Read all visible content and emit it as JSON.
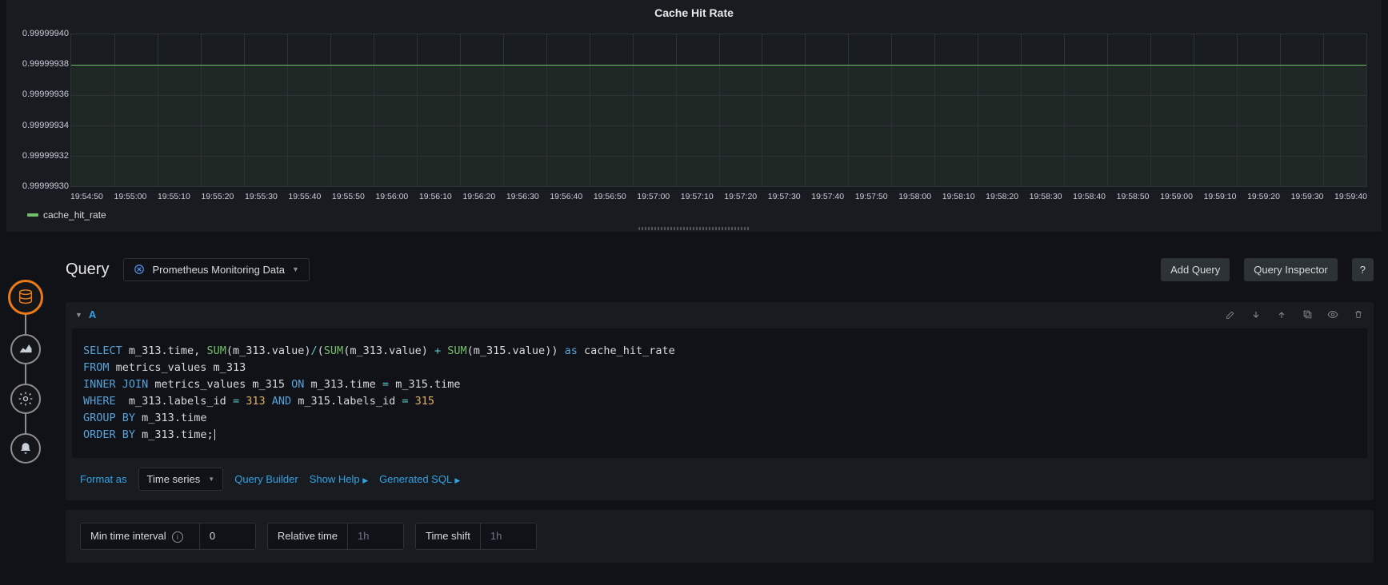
{
  "chart_data": {
    "type": "line",
    "title": "Cache Hit Rate",
    "xlabel": "",
    "ylabel": "",
    "ylim": [
      0.9999993,
      0.9999994
    ],
    "y_ticks": [
      "0.99999940",
      "0.99999938",
      "0.99999936",
      "0.99999934",
      "0.99999932",
      "0.99999930"
    ],
    "x_ticks": [
      "19:54:50",
      "19:55:00",
      "19:55:10",
      "19:55:20",
      "19:55:30",
      "19:55:40",
      "19:55:50",
      "19:56:00",
      "19:56:10",
      "19:56:20",
      "19:56:30",
      "19:56:40",
      "19:56:50",
      "19:57:00",
      "19:57:10",
      "19:57:20",
      "19:57:30",
      "19:57:40",
      "19:57:50",
      "19:58:00",
      "19:58:10",
      "19:58:20",
      "19:58:30",
      "19:58:40",
      "19:58:50",
      "19:59:00",
      "19:59:10",
      "19:59:20",
      "19:59:30",
      "19:59:40"
    ],
    "series": [
      {
        "name": "cache_hit_rate",
        "color": "#73bf69",
        "value": 0.99999938
      }
    ]
  },
  "legend": {
    "series_name": "cache_hit_rate"
  },
  "query_section": {
    "title": "Query",
    "datasource": "Prometheus Monitoring Data",
    "add_query_btn": "Add Query",
    "inspector_btn": "Query Inspector",
    "help_btn": "?",
    "query_letter": "A"
  },
  "sql": {
    "l1a": "SELECT",
    "l1b": " m_313.time, ",
    "l1c": "SUM",
    "l1d": "(m_313.value)",
    "l1e": "/",
    "l1f": "(",
    "l1g": "SUM",
    "l1h": "(m_313.value) ",
    "l1i": "+",
    "l1j": " ",
    "l1k": "SUM",
    "l1l": "(m_315.value)) ",
    "l1m": "as",
    "l1n": " cache_hit_rate",
    "l2a": "FROM",
    "l2b": " metrics_values m_313",
    "l3a": "INNER",
    "l3b": " ",
    "l3c": "JOIN",
    "l3d": " metrics_values m_315 ",
    "l3e": "ON",
    "l3f": " m_313.time ",
    "l3g": "=",
    "l3h": " m_315.time",
    "l4a": "WHERE",
    "l4b": "  m_313.labels_id ",
    "l4c": "=",
    "l4d": " ",
    "l4e": "313",
    "l4f": " ",
    "l4g": "AND",
    "l4h": " m_315.labels_id ",
    "l4i": "=",
    "l4j": " ",
    "l4k": "315",
    "l5a": "GROUP",
    "l5b": " ",
    "l5c": "BY",
    "l5d": " m_313.time",
    "l6a": "ORDER",
    "l6b": " ",
    "l6c": "BY",
    "l6d": " m_313.time;"
  },
  "options": {
    "format_as": "Format as",
    "format_value": "Time series",
    "query_builder": "Query Builder",
    "show_help": "Show Help",
    "generated_sql": "Generated SQL"
  },
  "time": {
    "min_interval_label": "Min time interval",
    "min_interval_value": "0",
    "relative_label": "Relative time",
    "relative_placeholder": "1h",
    "shift_label": "Time shift",
    "shift_placeholder": "1h"
  }
}
